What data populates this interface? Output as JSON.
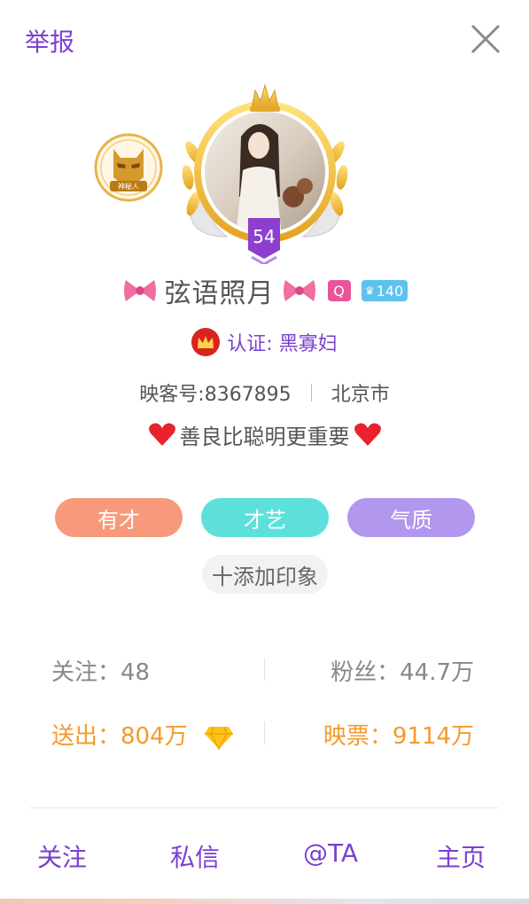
{
  "header": {
    "report_label": "举报",
    "close_icon": "close-icon"
  },
  "left_badge": {
    "text": "神秘人",
    "icon": "mystery-mask-badge-icon"
  },
  "profile": {
    "level": "54",
    "name": "弦语照月",
    "name_decor_icon": "pink-bow-icon",
    "q_badge": "Q",
    "crown_level": "140",
    "verify_label": "认证: 黑寡妇",
    "id_label": "映客号:8367895",
    "city": "北京市",
    "signature": "善良比聪明更重要",
    "signature_decor_icon": "red-heart-icon"
  },
  "impressions": {
    "tags": [
      "有才",
      "才艺",
      "气质"
    ],
    "add_label": "十添加印象"
  },
  "stats": {
    "follow": "关注：48",
    "fans": "粉丝：44.7万",
    "sent": "送出：804万",
    "tickets": "映票：9114万"
  },
  "actions": {
    "follow": "关注",
    "message": "私信",
    "mention": "@TA",
    "home": "主页"
  },
  "colors": {
    "accent": "#7b3fd1",
    "orange": "#f39b2a",
    "pill1": "#f7997a",
    "pill2": "#5de0dc",
    "pill3": "#b197ed"
  }
}
